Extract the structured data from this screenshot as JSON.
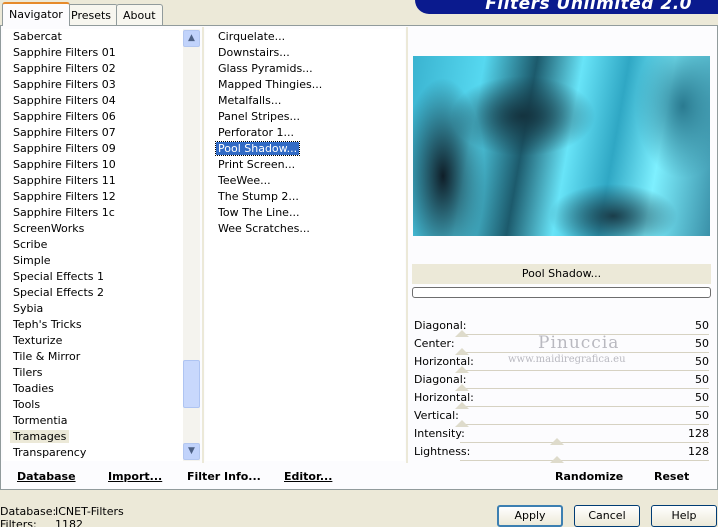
{
  "tabs": [
    "Navigator",
    "Presets",
    "About"
  ],
  "app_title": "Filters Unlimited 2.0",
  "categories": {
    "items": [
      "Sabercat",
      "Sapphire Filters 01",
      "Sapphire Filters 02",
      "Sapphire Filters 03",
      "Sapphire Filters 04",
      "Sapphire Filters 06",
      "Sapphire Filters 07",
      "Sapphire Filters 09",
      "Sapphire Filters 10",
      "Sapphire Filters 11",
      "Sapphire Filters 12",
      "Sapphire Filters 1c",
      "ScreenWorks",
      "Scribe",
      "Simple",
      "Special Effects 1",
      "Special Effects 2",
      "Sybia",
      "Teph's Tricks",
      "Texturize",
      "Tile & Mirror",
      "Tilers",
      "Toadies",
      "Tools",
      "Tormentia",
      "Tramages",
      "Transparency"
    ],
    "selected": "Tramages"
  },
  "filters": {
    "items": [
      "Cirquelate...",
      "Downstairs...",
      "Glass Pyramids...",
      "Mapped Thingies...",
      "Metalfalls...",
      "Panel Stripes...",
      "Perforator 1...",
      "Pool Shadow...",
      "Print Screen...",
      "TeeWee...",
      "The Stump 2...",
      "Tow The Line...",
      "Wee Scratches..."
    ],
    "selected": "Pool Shadow..."
  },
  "preview": {
    "filter_name": "Pool Shadow..."
  },
  "sliders": [
    {
      "label": "Diagonal:",
      "value": "50",
      "level": 0.0
    },
    {
      "label": "Center:",
      "value": "50",
      "level": 0.0
    },
    {
      "label": "Horizontal:",
      "value": "50",
      "level": 0.0
    },
    {
      "label": "Diagonal:",
      "value": "50",
      "level": 0.0
    },
    {
      "label": "Horizontal:",
      "value": "50",
      "level": 0.0
    },
    {
      "label": "Vertical:",
      "value": "50",
      "level": 0.0
    },
    {
      "label": "Intensity:",
      "value": "128",
      "level": 0.502
    },
    {
      "label": "Lightness:",
      "value": "128",
      "level": 0.502
    }
  ],
  "toolbar": {
    "database": "Database",
    "import": "Import...",
    "filter_info": "Filter Info...",
    "editor": "Editor...",
    "randomize": "Randomize",
    "reset": "Reset"
  },
  "status": {
    "database_label": "Database:",
    "database_value": "ICNET-Filters",
    "filters_label": "Filters:",
    "filters_value": "1182"
  },
  "buttons": {
    "apply": "Apply",
    "cancel": "Cancel",
    "help": "Help"
  },
  "watermark": {
    "name": "Pinuccia",
    "url": "www.maidiregrafica.eu"
  },
  "colors": {
    "selection": "#316ac5",
    "banner": "#0a1a8e",
    "background": "#ece9d8"
  }
}
